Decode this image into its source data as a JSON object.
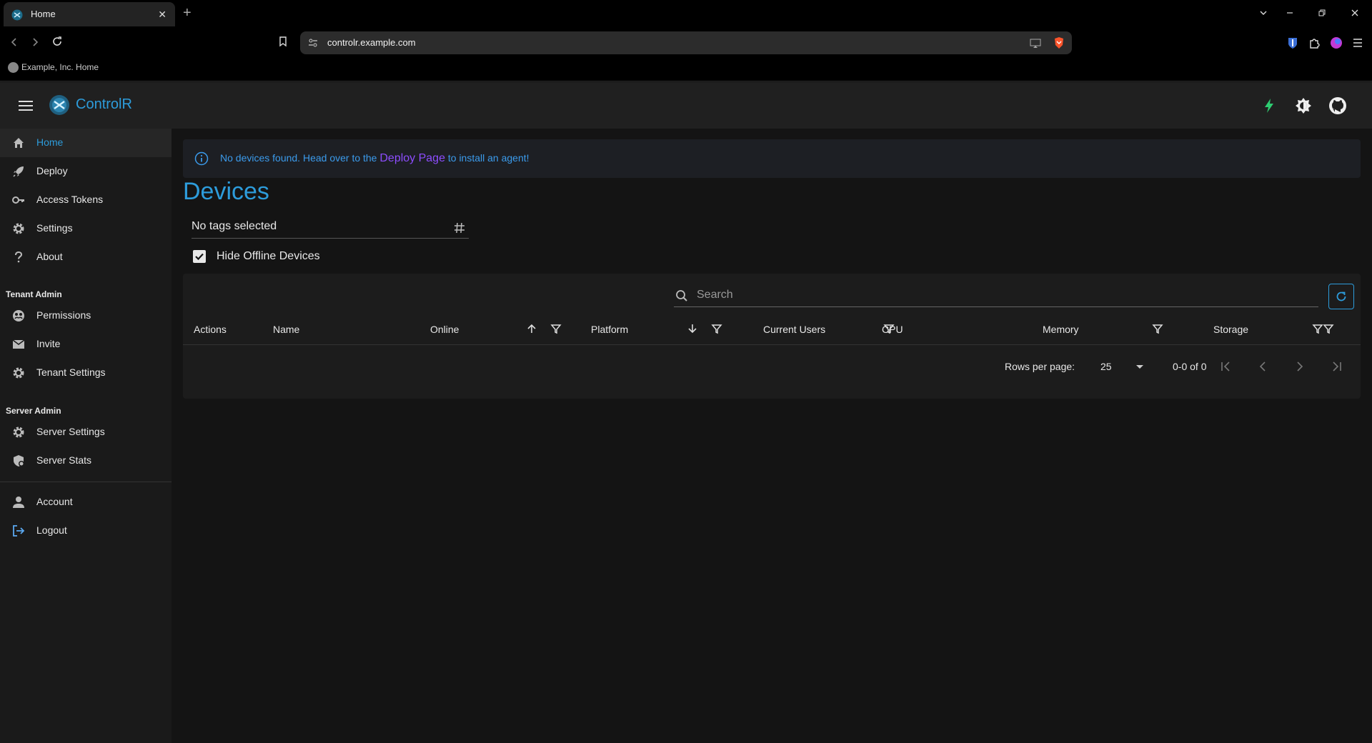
{
  "browser": {
    "tab_title": "Home",
    "tab_close": "✕",
    "new_tab": "+",
    "url": "controlr.example.com",
    "bookmark": "Example, Inc. Home"
  },
  "app": {
    "title": "ControlR"
  },
  "sidebar": {
    "items": [
      {
        "label": "Home",
        "icon": "home-icon",
        "active": true
      },
      {
        "label": "Deploy",
        "icon": "rocket-icon"
      },
      {
        "label": "Access Tokens",
        "icon": "key-icon"
      },
      {
        "label": "Settings",
        "icon": "gear-icon"
      },
      {
        "label": "About",
        "icon": "question-icon"
      }
    ],
    "tenant_admin": {
      "heading": "Tenant Admin",
      "items": [
        {
          "label": "Permissions",
          "icon": "permissions-icon"
        },
        {
          "label": "Invite",
          "icon": "mail-icon"
        },
        {
          "label": "Tenant Settings",
          "icon": "gear-icon"
        }
      ]
    },
    "server_admin": {
      "heading": "Server Admin",
      "items": [
        {
          "label": "Server Settings",
          "icon": "gear-icon"
        },
        {
          "label": "Server Stats",
          "icon": "stats-icon"
        }
      ]
    },
    "account_items": [
      {
        "label": "Account",
        "icon": "person-icon"
      },
      {
        "label": "Logout",
        "icon": "logout-icon"
      }
    ]
  },
  "alert": {
    "prefix": "No devices found. Head over to the",
    "link": "Deploy Page",
    "suffix": "to install an agent!"
  },
  "devices": {
    "title": "Devices",
    "tag_select_value": "No tags selected",
    "hide_offline_label": "Hide Offline Devices",
    "hide_offline_checked": true,
    "search_placeholder": "Search",
    "columns": [
      "Actions",
      "Name",
      "Online",
      "Platform",
      "Current Users",
      "CPU",
      "Memory",
      "Storage"
    ],
    "rows_per_page_label": "Rows per page:",
    "rows_per_page": "25",
    "page_range": "0-0 of 0"
  },
  "colors": {
    "accent": "#2d9cdb",
    "link": "#8d4dff",
    "bolt": "#2ecc71"
  }
}
